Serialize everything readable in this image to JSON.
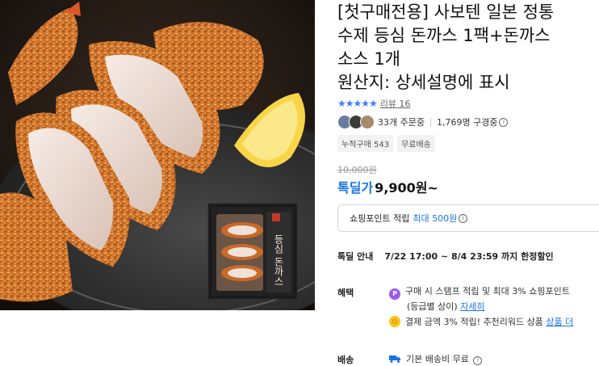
{
  "product": {
    "title_lines": [
      "[첫구매전용] 사보텐 일본 정통",
      "수제 등심 돈까스 1팩+돈까스",
      "소스 1개",
      "원산지: 상세설명에 표시"
    ],
    "package_label": "등심 돈까스"
  },
  "reviews": {
    "stars": "★★★★★",
    "link_text": "리뷰 16"
  },
  "buyers": {
    "order_count": "33개 주문중",
    "viewer_count": "1,769명 구경중",
    "info_icon": "ⓘ"
  },
  "badges": [
    "누적구매 543",
    "무료배송"
  ],
  "price": {
    "original": "10,000원",
    "deal_label": "톡딜가",
    "deal_price": "9,900원~"
  },
  "points": {
    "label": "쇼핑포인트 적립",
    "highlight": "최대 500원",
    "info_icon": "ⓘ"
  },
  "deal_info": {
    "label": "톡딜 안내",
    "period": "7/22 17:00 ~ 8/4 23:59 까지 한정할인"
  },
  "benefits": {
    "label": "혜택",
    "item1_line1": "구매 시 스탬프 적립 및 최대 3% 쇼핑포인트",
    "item1_line2": "(등급별 상이)",
    "item1_link": "자세히",
    "item2_text": "결제 금액 3% 적립! 추천리워드 상품",
    "item2_link": "상품 더",
    "p_icon_text": "P"
  },
  "shipping": {
    "label": "배송",
    "text": "기본 배송비 무료"
  },
  "colors": {
    "accent": "#1a73e8",
    "star": "#3f7dff",
    "point_purple": "#9b59f5",
    "coin_yellow": "#ffc21a"
  }
}
